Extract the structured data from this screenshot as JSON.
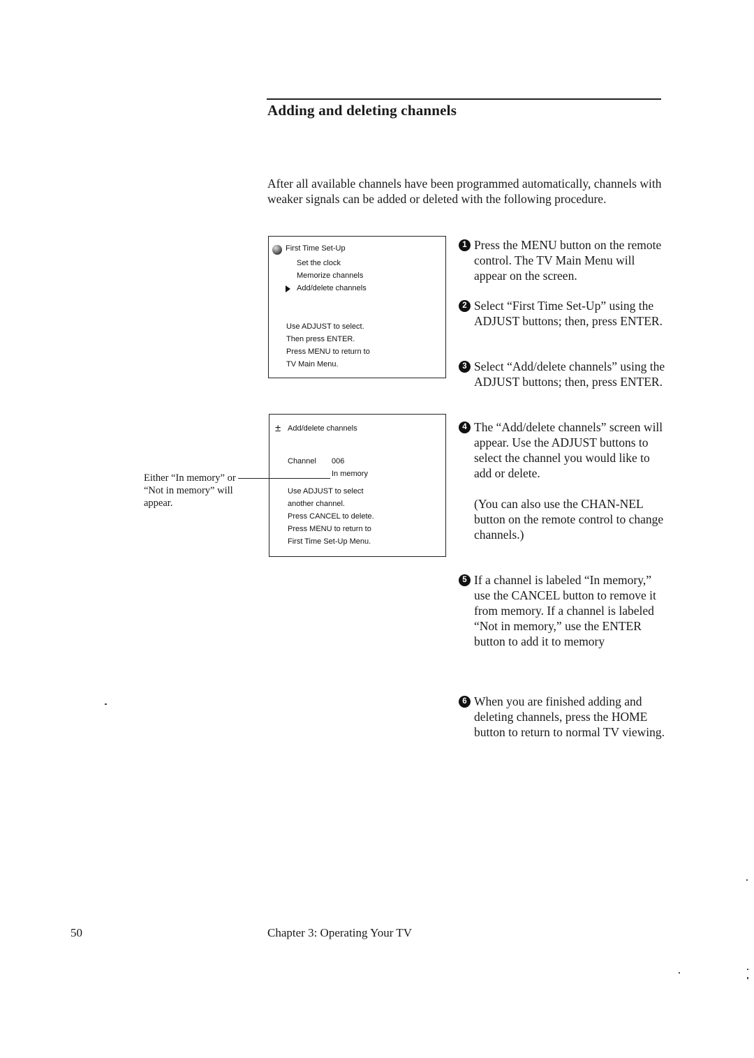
{
  "section": {
    "title": "Adding and deleting channels",
    "intro": "After all available channels have been programmed automatically, channels with weaker signals can be added or deleted with the following procedure."
  },
  "screens": {
    "first_time_setup": {
      "icon": "globe-icon",
      "title": "First Time Set-Up",
      "menu_items": [
        {
          "label": "Set the clock",
          "selected": false
        },
        {
          "label": "Memorize channels",
          "selected": false
        },
        {
          "label": "Add/delete channels",
          "selected": true
        }
      ],
      "instructions": [
        "Use ADJUST to select.",
        "Then press ENTER.",
        "Press MENU to return to",
        "TV Main Menu."
      ]
    },
    "add_delete": {
      "icon": "plus-minus-icon",
      "title": "Add/delete channels",
      "channel_label": "Channel",
      "channel_value": "006",
      "status": "In memory",
      "instructions": [
        "Use ADJUST to select",
        "another channel.",
        "Press CANCEL to delete.",
        "Press MENU to return to",
        "First Time Set-Up Menu."
      ]
    }
  },
  "callout": {
    "lines": [
      "Either “In memory” or",
      "“Not in memory” will",
      "appear."
    ]
  },
  "steps": [
    {
      "number": "1",
      "paragraphs": [
        "Press the MENU button on the remote control. The TV Main Menu will appear on the screen."
      ]
    },
    {
      "number": "2",
      "paragraphs": [
        "Select “First Time Set-Up” using the ADJUST buttons; then, press ENTER."
      ]
    },
    {
      "number": "3",
      "paragraphs": [
        "Select “Add/delete channels” using the ADJUST buttons; then, press ENTER."
      ]
    },
    {
      "number": "4",
      "paragraphs": [
        "The “Add/delete channels” screen will appear. Use the ADJUST buttons to select the channel you would like to add or delete.",
        "(You can also use the CHAN-NEL button on the remote control to change channels.)"
      ]
    },
    {
      "number": "5",
      "paragraphs": [
        "If a channel is labeled “In memory,” use the CANCEL button to remove it from memory. If a channel is labeled “Not in memory,” use the ENTER button to add it to memory"
      ]
    },
    {
      "number": "6",
      "paragraphs": [
        "When you are finished adding and deleting channels, press the HOME button to return to normal TV viewing."
      ]
    }
  ],
  "footer": {
    "page_number": "50",
    "chapter": "Chapter 3: Operating Your TV"
  }
}
